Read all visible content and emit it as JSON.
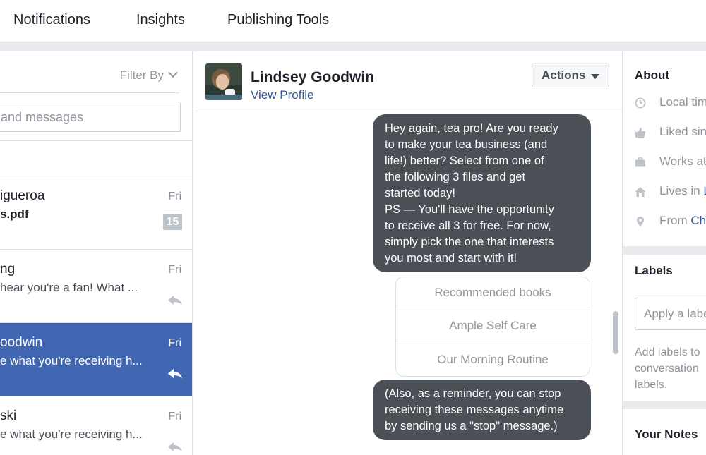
{
  "topnav": {
    "tabs": [
      "Notifications",
      "Insights",
      "Publishing Tools"
    ]
  },
  "left": {
    "filter_label": "Filter By",
    "search_placeholder": "and messages",
    "conversations": [
      {
        "name": "igueroa",
        "snippet": "s.pdf",
        "date": "Fri",
        "badge": "15",
        "selected": false
      },
      {
        "name": "ng",
        "snippet": "hear you're a fan! What ...",
        "date": "Fri",
        "selected": false
      },
      {
        "name": "oodwin",
        "snippet": "e what you're receiving h...",
        "date": "Fri",
        "selected": true
      },
      {
        "name": "ski",
        "snippet": "e what you're receiving h...",
        "date": "Fri",
        "selected": false
      }
    ]
  },
  "conversation": {
    "name": "Lindsey Goodwin",
    "view_profile": "View Profile",
    "actions_label": "Actions",
    "message1": "Hey again, tea pro! Are you ready to make your tea business (and life!) better? Select from one of the following 3 files and get started today! PS — You'll have the opportunity to receive all 3 for free. For now, simply pick the one that interests you most and start with it!",
    "message1_lines": [
      "Hey again, tea pro! Are you ready",
      "to make your tea business (and",
      "life!) better? Select from one of",
      "the following 3 files and get",
      "started today!",
      "PS — You'll have the opportunity",
      "to receive all 3 for free. For now,",
      "simply pick the one that interests",
      "you most and start with it!"
    ],
    "quick_replies": [
      "Recommended books",
      "Ample Self Care",
      "Our Morning Routine"
    ],
    "message2_lines": [
      "(Also, as a reminder, you can stop",
      "receiving these messages anytime",
      "by sending us a \"stop\" message.)"
    ]
  },
  "about": {
    "title": "About",
    "rows": [
      {
        "icon": "clock-icon",
        "text": "Local tim",
        "link": ""
      },
      {
        "icon": "thumbs-up-icon",
        "text": "Liked sin",
        "link": ""
      },
      {
        "icon": "briefcase-icon",
        "text": "Works at",
        "link": ""
      },
      {
        "icon": "home-icon",
        "text": "Lives in ",
        "link": "L"
      },
      {
        "icon": "location-pin-icon",
        "text": "From ",
        "link": "Ch"
      }
    ]
  },
  "labels": {
    "title": "Labels",
    "input_placeholder": "Apply a labe",
    "help_lines": [
      "Add labels to",
      "conversation",
      "labels."
    ]
  },
  "notes": {
    "title": "Your Notes"
  },
  "colors": {
    "accent": "#4267b2",
    "bubble": "#4b4f56",
    "link": "#365899"
  }
}
